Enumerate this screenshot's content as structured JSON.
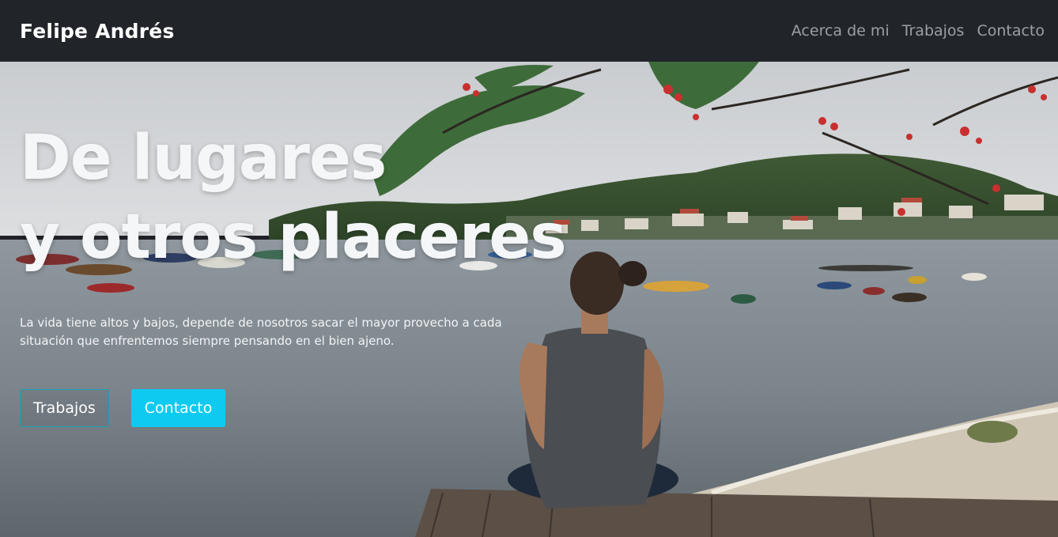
{
  "navbar": {
    "brand": "Felipe Andrés",
    "links": [
      "Acerca de mi",
      "Trabajos",
      "Contacto"
    ]
  },
  "hero": {
    "headline_line1": "De lugares",
    "headline_line2": "y otros placeres",
    "lead": "La vida tiene altos y bajos, depende de nosotros sacar el mayor provecho a cada situación que enfrentemos siempre pensando en el bien ajeno.",
    "buttons": {
      "primary": "Trabajos",
      "secondary": "Contacto"
    }
  },
  "colors": {
    "navbar_bg": "#212429",
    "accent": "#0fcaf0",
    "outline_border": "#17a2b8"
  }
}
